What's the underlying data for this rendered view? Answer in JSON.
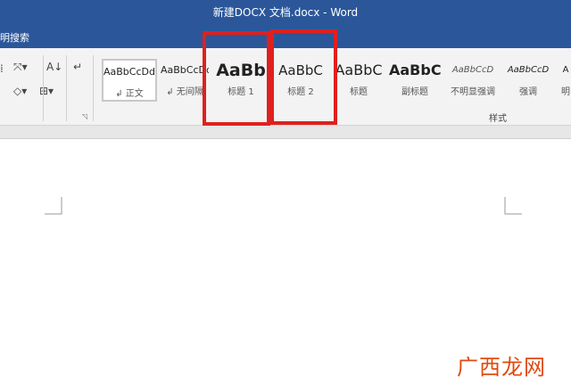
{
  "window": {
    "title": "新建DOCX 文档.docx - Word"
  },
  "tellme": {
    "label": "明搜索"
  },
  "styles_gallery": {
    "items": [
      {
        "preview": "AaBbCcDd",
        "label": "正文",
        "mark": "↲"
      },
      {
        "preview": "AaBbCcDd",
        "label": "无间隔",
        "mark": "↲"
      },
      {
        "preview": "AaBb",
        "label": "标题 1"
      },
      {
        "preview": "AaBbC",
        "label": "标题 2"
      },
      {
        "preview": "AaBbC",
        "label": "标题"
      },
      {
        "preview": "AaBbC",
        "label": "副标题"
      },
      {
        "preview": "AaBbCcD",
        "label": "不明显强调"
      },
      {
        "preview": "AaBbCcD",
        "label": "强调"
      },
      {
        "preview": "A",
        "label": "明"
      }
    ],
    "group_label": "样式"
  },
  "watermark": {
    "text": "广西龙网"
  },
  "colors": {
    "ribbon_blue": "#2b579a",
    "highlight": "#e0201e"
  }
}
